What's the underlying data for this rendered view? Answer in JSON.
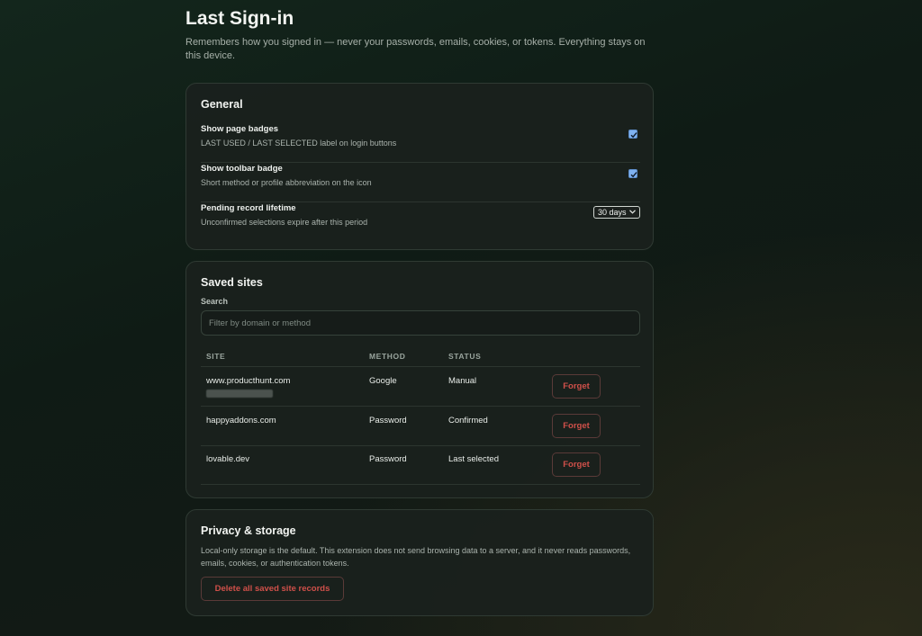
{
  "header": {
    "title": "Last Sign-in",
    "description": "Remembers how you signed in — never your passwords, emails, cookies, or tokens. Everything stays on this device."
  },
  "general": {
    "title": "General",
    "settings": [
      {
        "label": "Show page badges",
        "help": "LAST USED / LAST SELECTED label on login buttons",
        "control": "checkbox",
        "checked": true
      },
      {
        "label": "Show toolbar badge",
        "help": "Short method or profile abbreviation on the icon",
        "control": "checkbox",
        "checked": true
      },
      {
        "label": "Pending record lifetime",
        "help": "Unconfirmed selections expire after this period",
        "control": "select",
        "value": "30 days"
      }
    ]
  },
  "saved_sites": {
    "title": "Saved sites",
    "search_label": "Search",
    "search_placeholder": "Filter by domain or method",
    "columns": [
      "SITE",
      "METHOD",
      "STATUS"
    ],
    "rows": [
      {
        "site": "www.producthunt.com",
        "method": "Google",
        "status": "Manual",
        "action": "Forget",
        "profile_masked": true
      },
      {
        "site": "happyaddons.com",
        "method": "Password",
        "status": "Confirmed",
        "action": "Forget"
      },
      {
        "site": "lovable.dev",
        "method": "Password",
        "status": "Last selected",
        "action": "Forget"
      }
    ]
  },
  "privacy": {
    "title": "Privacy & storage",
    "text": "Local-only storage is the default. This extension does not send browsing data to a server, and it never reads passwords, emails, cookies, or authentication tokens.",
    "delete_label": "Delete all saved site records"
  },
  "colors": {
    "accent_danger": "#d0504a",
    "checkbox": "#7fb2f0",
    "card_bg": "#1a211d"
  }
}
